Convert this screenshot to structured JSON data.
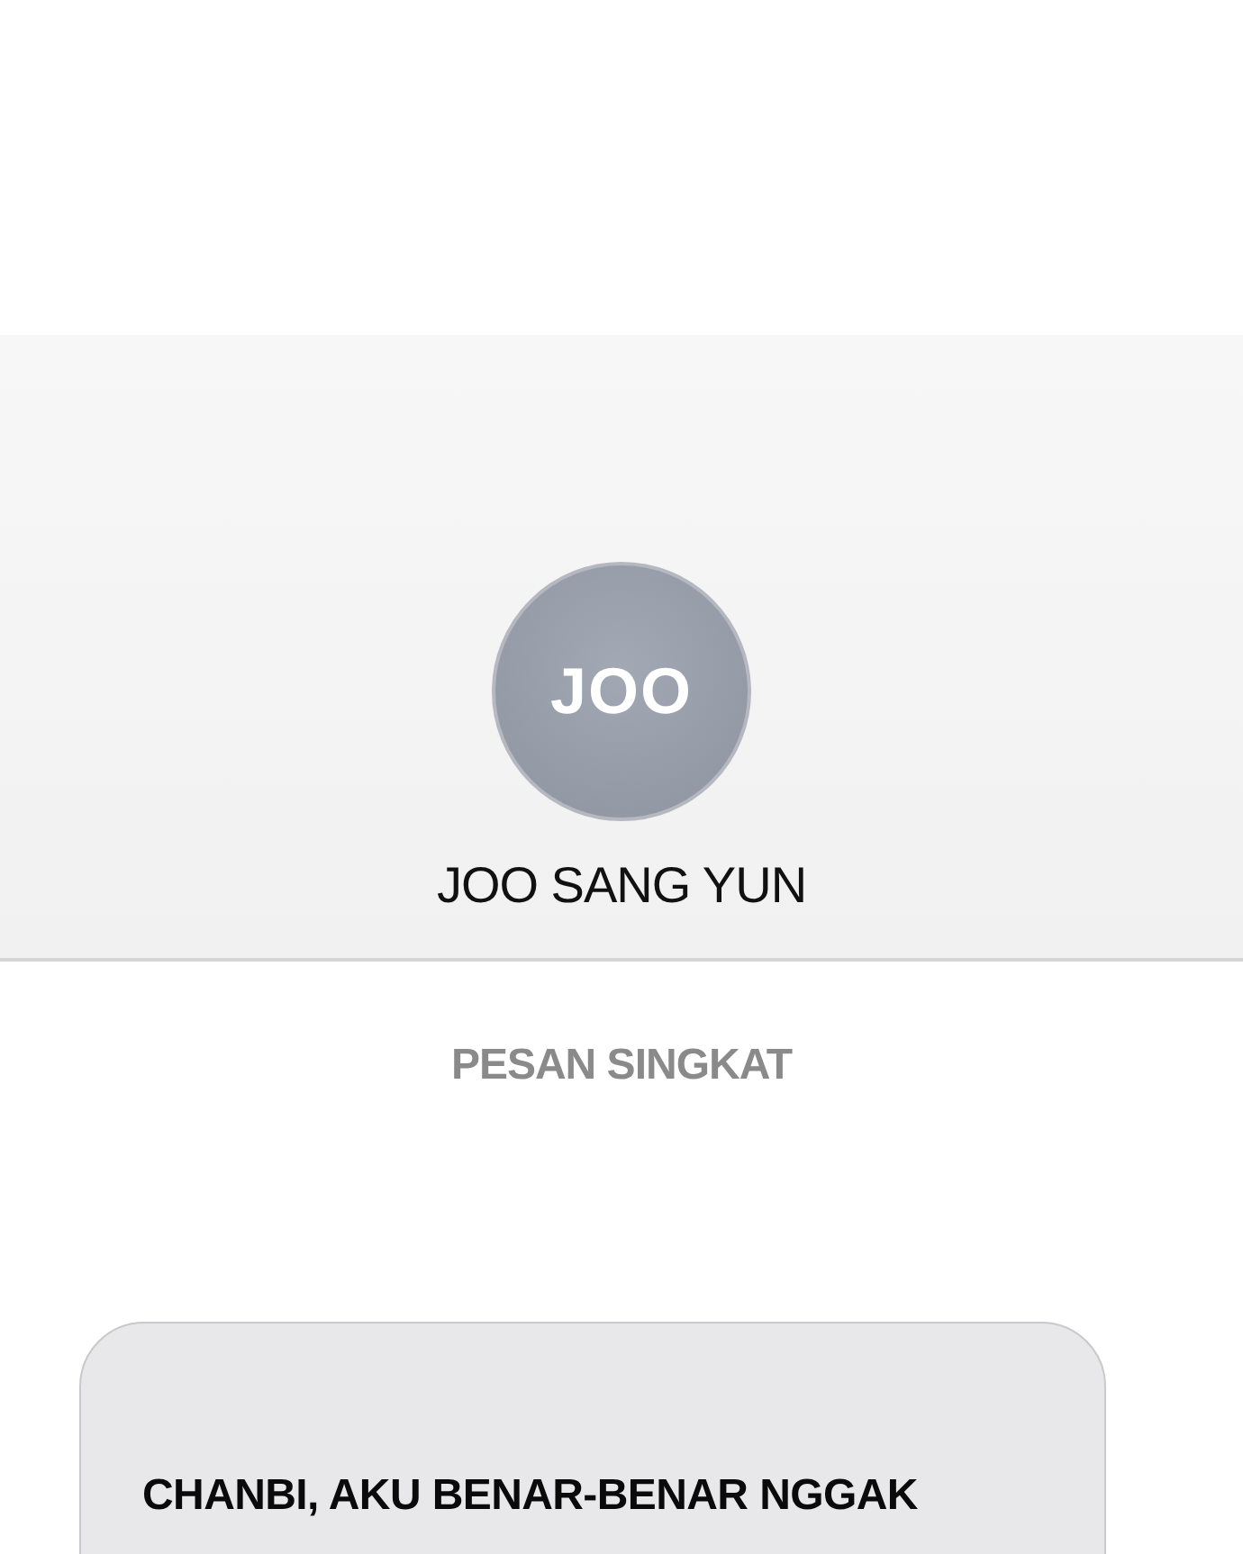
{
  "contact": {
    "avatar_initials": "JOO",
    "name": "JOO SANG YUN"
  },
  "section_label": "PESAN SINGKAT",
  "messages": [
    {
      "text": "CHANBI, AKU BENAR-BENAR NGGAK"
    }
  ]
}
